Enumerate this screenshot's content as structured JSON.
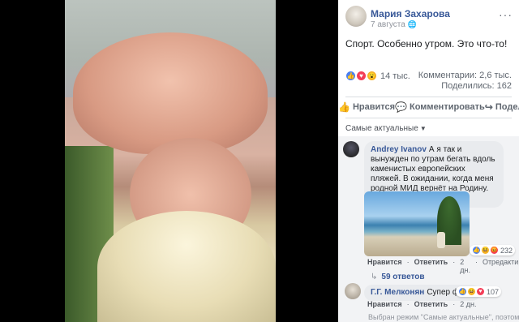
{
  "post": {
    "author": "Мария Захарова",
    "date": "7 августа",
    "text": "Спорт. Особенно утром. Это что-то!",
    "reaction_count": "14 тыс.",
    "comments_count": "Комментарии: 2,6 тыс.",
    "shares_count": "Поделились: 162"
  },
  "actions": {
    "like": "Нравится",
    "comment": "Комментировать",
    "share": "Поделиться"
  },
  "sort_label": "Самые актуальные",
  "comments": [
    {
      "author": "Andrey Ivanov",
      "text": "А я так и вынужден по утрам бегать вдоль каменистых европейских пляжей. В ожидании, когда меня родной МИД вернёт на Родину. Сижу вот жду.",
      "reaction_count": "232",
      "like_label": "Нравится",
      "reply_label": "Ответить",
      "time": "2 дн.",
      "edited_label": "Отредактировано",
      "replies_label": "59 ответов"
    },
    {
      "author": "Г.Г. Мелконян",
      "text": "Супер фото!",
      "reaction_count": "107",
      "like_label": "Нравится",
      "reply_label": "Ответить",
      "time": "2 дн."
    }
  ],
  "notice": "Выбран режим \"Самые актуальные\", поэтому",
  "icons": {
    "globe": "globe-icon",
    "more": "more-icon",
    "like": "thumbs-up-icon",
    "comment": "comment-icon",
    "share": "share-icon"
  },
  "colors": {
    "link": "#385898",
    "like": "#4a7ff0",
    "love": "#f33e58",
    "wow": "#f7b125"
  }
}
